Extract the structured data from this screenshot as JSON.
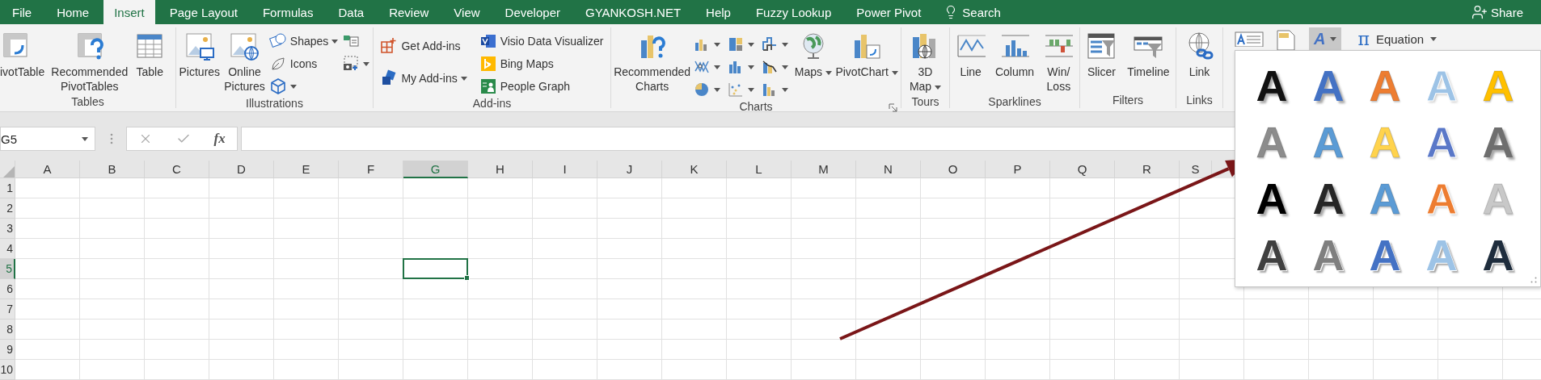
{
  "tabs": [
    {
      "label": "File",
      "selected": false
    },
    {
      "label": "Home",
      "selected": false
    },
    {
      "label": "Insert",
      "selected": true
    },
    {
      "label": "Page Layout",
      "selected": false
    },
    {
      "label": "Formulas",
      "selected": false
    },
    {
      "label": "Data",
      "selected": false
    },
    {
      "label": "Review",
      "selected": false
    },
    {
      "label": "View",
      "selected": false
    },
    {
      "label": "Developer",
      "selected": false
    },
    {
      "label": "GYANKOSH.NET",
      "selected": false
    },
    {
      "label": "Help",
      "selected": false
    },
    {
      "label": "Fuzzy Lookup",
      "selected": false
    },
    {
      "label": "Power Pivot",
      "selected": false
    }
  ],
  "search": {
    "label": "Search"
  },
  "share": {
    "label": "Share"
  },
  "ribbon_groups": [
    {
      "label": "Tables",
      "items": [
        {
          "kind": "large",
          "label": "ivotTable",
          "dropdown": false
        },
        {
          "kind": "large",
          "label": "Recommended\nPivotTables",
          "dropdown": false
        },
        {
          "kind": "large",
          "label": "Table",
          "dropdown": false
        }
      ]
    },
    {
      "label": "Illustrations",
      "items": [
        {
          "kind": "large",
          "label": "Pictures",
          "dropdown": false
        },
        {
          "kind": "large",
          "label": "Online\nPictures",
          "dropdown": false
        },
        {
          "kind": "stack",
          "buttons": [
            {
              "label": "Shapes",
              "dropdown": true
            },
            {
              "label": "Icons",
              "dropdown": false
            },
            {
              "dropdown": true
            }
          ]
        },
        {
          "kind": "stack",
          "buttons": [
            {
              "dropdown": false
            },
            {
              "dropdown": true
            }
          ]
        }
      ]
    },
    {
      "label": "Add-ins",
      "items": [
        {
          "kind": "stack",
          "buttons": [
            {
              "label": "Get Add-ins",
              "dropdown": false
            },
            {
              "label": "My Add-ins",
              "dropdown": true
            }
          ]
        },
        {
          "kind": "stack",
          "buttons": [
            {
              "label": "Visio Data Visualizer",
              "dropdown": false
            },
            {
              "label": "Bing Maps",
              "dropdown": false
            },
            {
              "label": "People Graph",
              "dropdown": false
            }
          ]
        }
      ]
    },
    {
      "label": "Charts",
      "launcher": true,
      "items": [
        {
          "kind": "large",
          "label": "Recommended\nCharts",
          "dropdown": false
        },
        {
          "kind": "grid",
          "buttons": [
            {
              "dropdown": true
            },
            {
              "dropdown": true
            },
            {
              "dropdown": true
            },
            {
              "dropdown": true
            },
            {
              "dropdown": true
            },
            {
              "dropdown": true
            },
            {
              "dropdown": true
            },
            {
              "dropdown": true
            },
            {
              "dropdown": true
            }
          ]
        },
        {
          "kind": "large",
          "label": "Maps",
          "dropdown": true
        },
        {
          "kind": "large",
          "label": "PivotChart",
          "dropdown": true
        }
      ]
    },
    {
      "label": "Tours",
      "items": [
        {
          "kind": "large",
          "label": "3D\nMap",
          "dropdown": true
        }
      ]
    },
    {
      "label": "Sparklines",
      "items": [
        {
          "kind": "large",
          "label": "Line",
          "dropdown": false
        },
        {
          "kind": "large",
          "label": "Column",
          "dropdown": false
        },
        {
          "kind": "large",
          "label": "Win/\nLoss",
          "dropdown": false
        }
      ]
    },
    {
      "label": "Filters",
      "items": [
        {
          "kind": "large",
          "label": "Slicer",
          "dropdown": false
        },
        {
          "kind": "large",
          "label": "Timeline",
          "dropdown": false
        }
      ]
    },
    {
      "label": "Links",
      "items": [
        {
          "kind": "large",
          "label": "Link",
          "dropdown": false
        }
      ]
    },
    {
      "items": [
        {
          "kind": "icon"
        },
        {
          "kind": "icon"
        },
        {
          "kind": "wordart",
          "label": "A",
          "selected": true
        },
        {
          "kind": "equation",
          "symbol": "π",
          "label": "Equation"
        }
      ]
    }
  ],
  "formula_bar": {
    "name_box": "G5",
    "function_label": "fx"
  },
  "sheet": {
    "columns": [
      {
        "label": "A",
        "selected": false
      },
      {
        "label": "B",
        "selected": false
      },
      {
        "label": "C",
        "selected": false
      },
      {
        "label": "D",
        "selected": false
      },
      {
        "label": "E",
        "selected": false
      },
      {
        "label": "F",
        "selected": false
      },
      {
        "label": "G",
        "selected": true
      },
      {
        "label": "H",
        "selected": false
      },
      {
        "label": "I",
        "selected": false
      },
      {
        "label": "J",
        "selected": false
      },
      {
        "label": "K",
        "selected": false
      },
      {
        "label": "L",
        "selected": false
      },
      {
        "label": "M",
        "selected": false
      },
      {
        "label": "N",
        "selected": false
      },
      {
        "label": "O",
        "selected": false
      },
      {
        "label": "P",
        "selected": false
      },
      {
        "label": "Q",
        "selected": false
      },
      {
        "label": "R",
        "selected": false
      },
      {
        "label": "S",
        "selected": false
      }
    ],
    "rows": [
      {
        "label": "1",
        "selected": false
      },
      {
        "label": "2",
        "selected": false
      },
      {
        "label": "3",
        "selected": false
      },
      {
        "label": "4",
        "selected": false
      },
      {
        "label": "5",
        "selected": true
      },
      {
        "label": "6",
        "selected": false
      },
      {
        "label": "7",
        "selected": false
      },
      {
        "label": "8",
        "selected": false
      },
      {
        "label": "9",
        "selected": false
      },
      {
        "label": "10",
        "selected": false
      }
    ]
  },
  "wordart_gallery": {
    "items": [
      {
        "label": "A",
        "kind": "shadow",
        "color": "#111111"
      },
      {
        "label": "A",
        "kind": "shadow",
        "color": "#4472c4"
      },
      {
        "label": "A",
        "kind": "solid",
        "color": "#ed7d31"
      },
      {
        "label": "A",
        "kind": "outline",
        "color": "#9dc3e6"
      },
      {
        "label": "A",
        "kind": "solid",
        "color": "#ffc000"
      },
      {
        "label": "A",
        "kind": "solid",
        "color": "#8c8c8c"
      },
      {
        "label": "A",
        "kind": "solid",
        "color": "#5b9bd5"
      },
      {
        "label": "A",
        "kind": "solid",
        "color": "#ffd34d"
      },
      {
        "label": "A",
        "kind": "outline",
        "color": "#5a78c8"
      },
      {
        "label": "A",
        "kind": "shadow",
        "color": "#6e6e6e"
      },
      {
        "label": "A",
        "kind": "shadow",
        "color": "#000000"
      },
      {
        "label": "A",
        "kind": "shadow",
        "color": "#262626"
      },
      {
        "label": "A",
        "kind": "solid",
        "color": "#5b9bd5"
      },
      {
        "label": "A",
        "kind": "outline",
        "color": "#ed7d31"
      },
      {
        "label": "A",
        "kind": "solid",
        "color": "#c8c8c8"
      },
      {
        "label": "A",
        "kind": "hatched",
        "color": "#404040"
      },
      {
        "label": "A",
        "kind": "hatched",
        "color": "#7f7f7f"
      },
      {
        "label": "A",
        "kind": "hatched",
        "color": "#4472c4"
      },
      {
        "label": "A",
        "kind": "hatched",
        "color": "#9dc3e6"
      },
      {
        "label": "A",
        "kind": "hatched",
        "color": "#1f2d3d"
      }
    ]
  }
}
